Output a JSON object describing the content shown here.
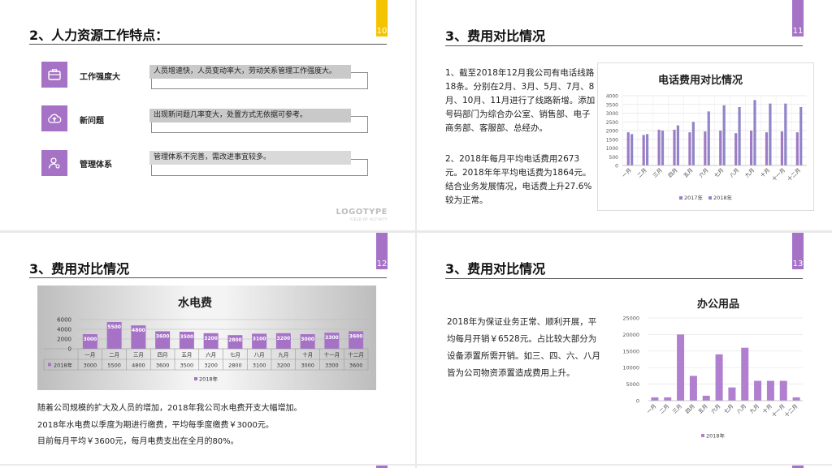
{
  "slide1": {
    "title": "2、人力资源工作特点：",
    "page_number": "10",
    "items": [
      {
        "label": "工作强度大",
        "text": "人员增速快，人员变动率大，劳动关系管理工作强度大。",
        "icon": "briefcase-icon"
      },
      {
        "label": "新问题",
        "text": "出现新问题几率变大，处置方式无依据可参考。",
        "icon": "cloud-upload-icon"
      },
      {
        "label": "管理体系",
        "text": "管理体系不完善，需改进事宜较多。",
        "icon": "user-settings-icon"
      }
    ],
    "logo": {
      "main": "LOGOTYPE",
      "sub": "FIELD OF ACTIVITY"
    }
  },
  "slide2": {
    "title": "3、费用对比情况",
    "page_number": "11",
    "para1": "1、截至2018年12月我公司有电话线路18条。分别在2月、3月、5月、7月、8月、10月、11月进行了线路新增。添加号码部门为综合办公室、销售部、电子商务部、客服部、总经办。",
    "para2": "2、2018年每月平均电话费用2673元。2018年年平均电话费为1864元。结合业务发展情况，电话费上升27.6%较为正常。"
  },
  "slide3": {
    "title": "3、费用对比情况",
    "page_number": "12",
    "lines": [
      "随着公司规模的扩大及人员的增加，2018年我公司水电费开支大幅增加。",
      "2018年水电费以季度为期进行缴费，平均每季度缴费￥3000元。",
      "目前每月平均￥3600元，每月电费支出在全月的80%。"
    ]
  },
  "slide4": {
    "title": "3、费用对比情况",
    "page_number": "13",
    "para": "2018年为保证业务正常、顺利开展，平均每月开销￥6528元。占比较大部分为设备添置所需开销。如三、四、六、八月皆为公司物资添置造成费用上升。"
  },
  "colors": {
    "accent_purple": "#a672c6",
    "accent_yellow": "#f5c400",
    "series_2017": "#9e7bc4",
    "series_2018": "#8e86c8"
  },
  "chart_data": [
    {
      "type": "bar",
      "title": "电话费用对比情况",
      "categories": [
        "一月",
        "二月",
        "三月",
        "四月",
        "五月",
        "六月",
        "七月",
        "八月",
        "九月",
        "十月",
        "十一月",
        "十二月"
      ],
      "series": [
        {
          "name": "2017年",
          "values": [
            1900,
            1750,
            2050,
            2050,
            1900,
            1950,
            2000,
            1850,
            2000,
            1900,
            1950,
            1900
          ]
        },
        {
          "name": "2018年",
          "values": [
            1800,
            1800,
            2000,
            2300,
            2500,
            3100,
            3450,
            3350,
            3750,
            3550,
            3550,
            3350
          ]
        }
      ],
      "ylim": [
        0,
        4000
      ],
      "yticks": [
        0,
        500,
        1000,
        1500,
        2000,
        2500,
        3000,
        3500,
        4000
      ],
      "legend": "bottom",
      "grid": true
    },
    {
      "type": "bar",
      "title": "水电费",
      "categories": [
        "一月",
        "二月",
        "三月",
        "四月",
        "五月",
        "六月",
        "七月",
        "八月",
        "九月",
        "十月",
        "十一月",
        "十二月"
      ],
      "series": [
        {
          "name": "2018年",
          "values": [
            3000,
            5500,
            4800,
            3600,
            3500,
            3200,
            2800,
            3100,
            3200,
            3000,
            3300,
            3600
          ]
        }
      ],
      "ylim": [
        0,
        6000
      ],
      "yticks": [
        0,
        2000,
        4000,
        6000
      ],
      "data_table": true,
      "legend": "bottom",
      "grid": true
    },
    {
      "type": "bar",
      "title": "办公用品",
      "categories": [
        "一月",
        "二月",
        "三月",
        "四月",
        "五月",
        "六月",
        "七月",
        "八月",
        "九月",
        "十月",
        "十一月",
        "十二月"
      ],
      "series": [
        {
          "name": "2018年",
          "values": [
            1000,
            1000,
            20000,
            7500,
            1500,
            14000,
            4000,
            16000,
            6000,
            6000,
            6000,
            1000
          ]
        }
      ],
      "ylim": [
        0,
        25000
      ],
      "yticks": [
        0,
        5000,
        10000,
        15000,
        20000,
        25000
      ],
      "legend": "bottom",
      "grid": true
    }
  ]
}
